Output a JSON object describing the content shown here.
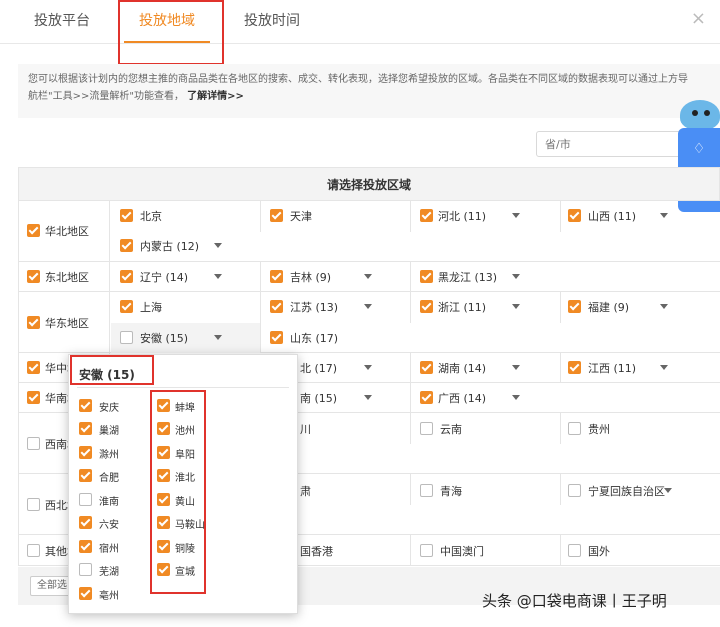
{
  "tabs": [
    {
      "label": "投放平台"
    },
    {
      "label": "投放地域"
    },
    {
      "label": "投放时间"
    }
  ],
  "close_symbol": "×",
  "info": {
    "line1": "您可以根据该计划内的您想主推的商品品类在各地区的搜索、成交、转化表现，选择您希望投放的区域。各品类在不同区域的数据表现可以通过上方导",
    "line2": "航栏\"工具>>流量解析\"功能查看，",
    "more": "了解详情>>"
  },
  "search": {
    "placeholder": "省/市"
  },
  "table_title": "请选择投放区域",
  "regions": [
    {
      "label": "华北地区",
      "checked": true
    },
    {
      "label": "东北地区",
      "checked": true
    },
    {
      "label": "华东地区",
      "checked": true
    },
    {
      "label": "华中地",
      "checked": true
    },
    {
      "label": "华南地",
      "checked": true
    },
    {
      "label": "西南地",
      "checked": false
    },
    {
      "label": "西北地",
      "checked": false
    },
    {
      "label": "其他地",
      "checked": false
    }
  ],
  "provinces": [
    {
      "label": "北京",
      "checked": true
    },
    {
      "label": "天津",
      "checked": true
    },
    {
      "label": "河北 (11)",
      "checked": true
    },
    {
      "label": "山西 (11)",
      "checked": true
    },
    {
      "label": "内蒙古 (12)",
      "checked": true
    },
    {
      "label": "辽宁 (14)",
      "checked": true
    },
    {
      "label": "吉林 (9)",
      "checked": true
    },
    {
      "label": "黑龙江 (13)",
      "checked": true
    },
    {
      "label": "上海",
      "checked": true
    },
    {
      "label": "江苏 (13)",
      "checked": true
    },
    {
      "label": "浙江 (11)",
      "checked": true
    },
    {
      "label": "福建 (9)",
      "checked": true
    },
    {
      "label": "安徽 (15)",
      "checked": false
    },
    {
      "label": "山东 (17)",
      "checked": true
    },
    {
      "label": "北 (17)",
      "checked": true
    },
    {
      "label": "湖南 (14)",
      "checked": true
    },
    {
      "label": "江西 (11)",
      "checked": true
    },
    {
      "label": "南 (15)",
      "checked": true
    },
    {
      "label": "广西 (14)",
      "checked": true
    },
    {
      "label": "川",
      "checked": false
    },
    {
      "label": "云南",
      "checked": false
    },
    {
      "label": "贵州",
      "checked": false
    },
    {
      "label": "肃",
      "checked": false
    },
    {
      "label": "青海",
      "checked": false
    },
    {
      "label": "宁夏回族自治区",
      "checked": false
    },
    {
      "label": "国香港",
      "checked": false
    },
    {
      "label": "中国澳门",
      "checked": false
    },
    {
      "label": "国外",
      "checked": false
    }
  ],
  "footer": {
    "all_button": "全部选"
  },
  "popup": {
    "title": "安徽 (15)",
    "col1": [
      {
        "label": "安庆",
        "checked": true
      },
      {
        "label": "巢湖",
        "checked": true
      },
      {
        "label": "滁州",
        "checked": true
      },
      {
        "label": "合肥",
        "checked": true
      },
      {
        "label": "淮南",
        "checked": false
      },
      {
        "label": "六安",
        "checked": true
      },
      {
        "label": "宿州",
        "checked": true
      },
      {
        "label": "芜湖",
        "checked": false
      },
      {
        "label": "亳州",
        "checked": true
      }
    ],
    "col2": [
      {
        "label": "蚌埠",
        "checked": true
      },
      {
        "label": "池州",
        "checked": true
      },
      {
        "label": "阜阳",
        "checked": true
      },
      {
        "label": "淮北",
        "checked": true
      },
      {
        "label": "黄山",
        "checked": true
      },
      {
        "label": "马鞍山",
        "checked": true
      },
      {
        "label": "铜陵",
        "checked": true
      },
      {
        "label": "宣城",
        "checked": true
      }
    ]
  },
  "side_widget": {
    "bell_icon": "bell-icon",
    "chat_icon": "chat-icon"
  },
  "watermark": "头条 @口袋电商课丨王子明",
  "colors": {
    "accent": "#f08a24",
    "highlight": "#e0332c",
    "widget": "#4a8ef5"
  }
}
